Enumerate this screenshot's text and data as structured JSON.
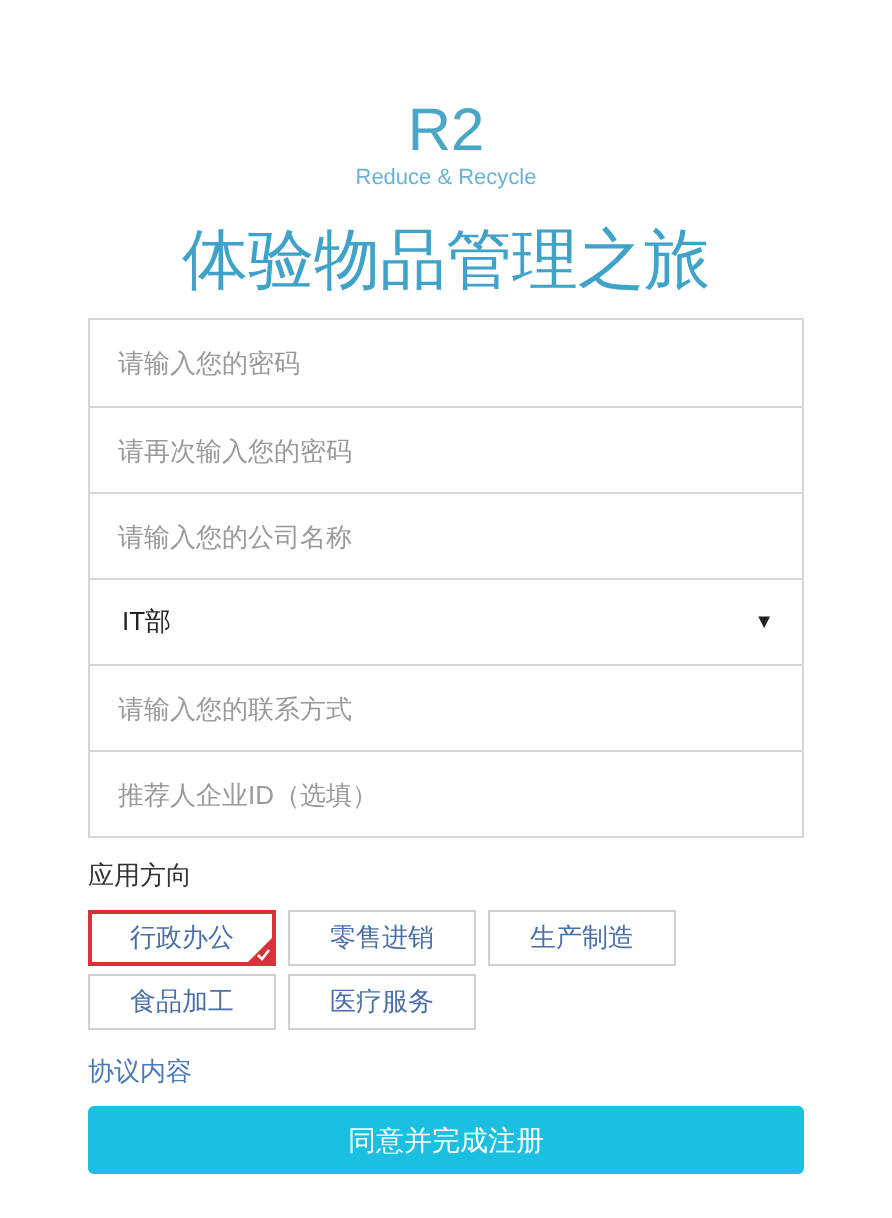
{
  "logo": {
    "mark": "R2",
    "tagline": "Reduce & Recycle"
  },
  "title": "体验物品管理之旅",
  "fields": [
    {
      "kind": "input",
      "placeholder": "请输入您的密码"
    },
    {
      "kind": "input",
      "placeholder": "请再次输入您的密码"
    },
    {
      "kind": "input",
      "placeholder": "请输入您的公司名称"
    },
    {
      "kind": "select",
      "value": "IT部",
      "caret": "▼"
    },
    {
      "kind": "input",
      "placeholder": "请输入您的联系方式"
    },
    {
      "kind": "input",
      "placeholder": "推荐人企业ID（选填）"
    }
  ],
  "section_label": "应用方向",
  "options": [
    {
      "label": "行政办公",
      "selected": true
    },
    {
      "label": "零售进销",
      "selected": false
    },
    {
      "label": "生产制造",
      "selected": false
    },
    {
      "label": "食品加工",
      "selected": false
    },
    {
      "label": "医疗服务",
      "selected": false
    }
  ],
  "agreement_link": "协议内容",
  "submit": "同意并完成注册"
}
